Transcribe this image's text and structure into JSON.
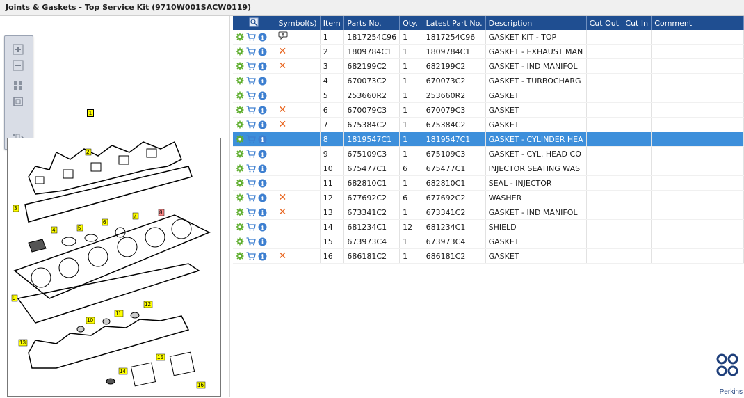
{
  "window": {
    "title": "Joints & Gaskets - Top Service Kit (9710W001SACW0119)"
  },
  "toolbar": {
    "buttons": [
      {
        "icon": "zoom-in-icon"
      },
      {
        "icon": "zoom-out-icon"
      },
      {
        "icon": "fit-all-icon"
      },
      {
        "icon": "fit-window-icon"
      },
      {
        "icon": "toggle-panel-icon"
      }
    ]
  },
  "drawing": {
    "callouts": [
      "1",
      "2",
      "3",
      "4",
      "5",
      "6",
      "7",
      "8",
      "9",
      "10",
      "11",
      "12",
      "13",
      "14",
      "15",
      "16"
    ]
  },
  "table": {
    "columns": [
      "",
      "Symbol(s)",
      "Item",
      "Parts No.",
      "Qty.",
      "Latest Part No.",
      "Description",
      "Cut Out",
      "Cut In",
      "Comment"
    ],
    "rows": [
      {
        "symbol": "note-icon",
        "item": "1",
        "part": "1817254C96",
        "qty": "1",
        "latest": "1817254C96",
        "desc": "GASKET KIT - TOP",
        "cut_out": "",
        "cut_in": "",
        "comment": ""
      },
      {
        "symbol": "not-available",
        "item": "2",
        "part": "1809784C1",
        "qty": "1",
        "latest": "1809784C1",
        "desc": "GASKET - EXHAUST MAN",
        "cut_out": "",
        "cut_in": "",
        "comment": ""
      },
      {
        "symbol": "not-available",
        "item": "3",
        "part": "682199C2",
        "qty": "1",
        "latest": "682199C2",
        "desc": "GASKET - IND MANIFOL",
        "cut_out": "",
        "cut_in": "",
        "comment": ""
      },
      {
        "symbol": "",
        "item": "4",
        "part": "670073C2",
        "qty": "1",
        "latest": "670073C2",
        "desc": "GASKET - TURBOCHARG",
        "cut_out": "",
        "cut_in": "",
        "comment": ""
      },
      {
        "symbol": "",
        "item": "5",
        "part": "253660R2",
        "qty": "1",
        "latest": "253660R2",
        "desc": "GASKET",
        "cut_out": "",
        "cut_in": "",
        "comment": ""
      },
      {
        "symbol": "not-available",
        "item": "6",
        "part": "670079C3",
        "qty": "1",
        "latest": "670079C3",
        "desc": "GASKET",
        "cut_out": "",
        "cut_in": "",
        "comment": ""
      },
      {
        "symbol": "not-available",
        "item": "7",
        "part": "675384C2",
        "qty": "1",
        "latest": "675384C2",
        "desc": "GASKET",
        "cut_out": "",
        "cut_in": "",
        "comment": ""
      },
      {
        "symbol": "",
        "item": "8",
        "part": "1819547C1",
        "qty": "1",
        "latest": "1819547C1",
        "desc": "GASKET - CYLINDER HEA",
        "cut_out": "",
        "cut_in": "",
        "comment": "",
        "selected": true
      },
      {
        "symbol": "",
        "item": "9",
        "part": "675109C3",
        "qty": "1",
        "latest": "675109C3",
        "desc": "GASKET - CYL. HEAD CO",
        "cut_out": "",
        "cut_in": "",
        "comment": ""
      },
      {
        "symbol": "",
        "item": "10",
        "part": "675477C1",
        "qty": "6",
        "latest": "675477C1",
        "desc": "INJECTOR SEATING WAS",
        "cut_out": "",
        "cut_in": "",
        "comment": ""
      },
      {
        "symbol": "",
        "item": "11",
        "part": "682810C1",
        "qty": "1",
        "latest": "682810C1",
        "desc": "SEAL - INJECTOR",
        "cut_out": "",
        "cut_in": "",
        "comment": ""
      },
      {
        "symbol": "not-available",
        "item": "12",
        "part": "677692C2",
        "qty": "6",
        "latest": "677692C2",
        "desc": "WASHER",
        "cut_out": "",
        "cut_in": "",
        "comment": ""
      },
      {
        "symbol": "not-available",
        "item": "13",
        "part": "673341C2",
        "qty": "1",
        "latest": "673341C2",
        "desc": "GASKET - IND MANIFOL",
        "cut_out": "",
        "cut_in": "",
        "comment": ""
      },
      {
        "symbol": "",
        "item": "14",
        "part": "681234C1",
        "qty": "12",
        "latest": "681234C1",
        "desc": "SHIELD",
        "cut_out": "",
        "cut_in": "",
        "comment": ""
      },
      {
        "symbol": "",
        "item": "15",
        "part": "673973C4",
        "qty": "1",
        "latest": "673973C4",
        "desc": "GASKET",
        "cut_out": "",
        "cut_in": "",
        "comment": ""
      },
      {
        "symbol": "not-available",
        "item": "16",
        "part": "686181C2",
        "qty": "1",
        "latest": "686181C2",
        "desc": "GASKET",
        "cut_out": "",
        "cut_in": "",
        "comment": ""
      }
    ]
  },
  "brand": {
    "name": "Perkins",
    "color": "#1d3e7a"
  },
  "colors": {
    "header": "#1f4e91",
    "selected_row": "#3d8fdb",
    "gear": "#5fae2e",
    "cart": "#3d7fd0",
    "info": "#3d7fd0",
    "x_mark": "#e8651f"
  }
}
